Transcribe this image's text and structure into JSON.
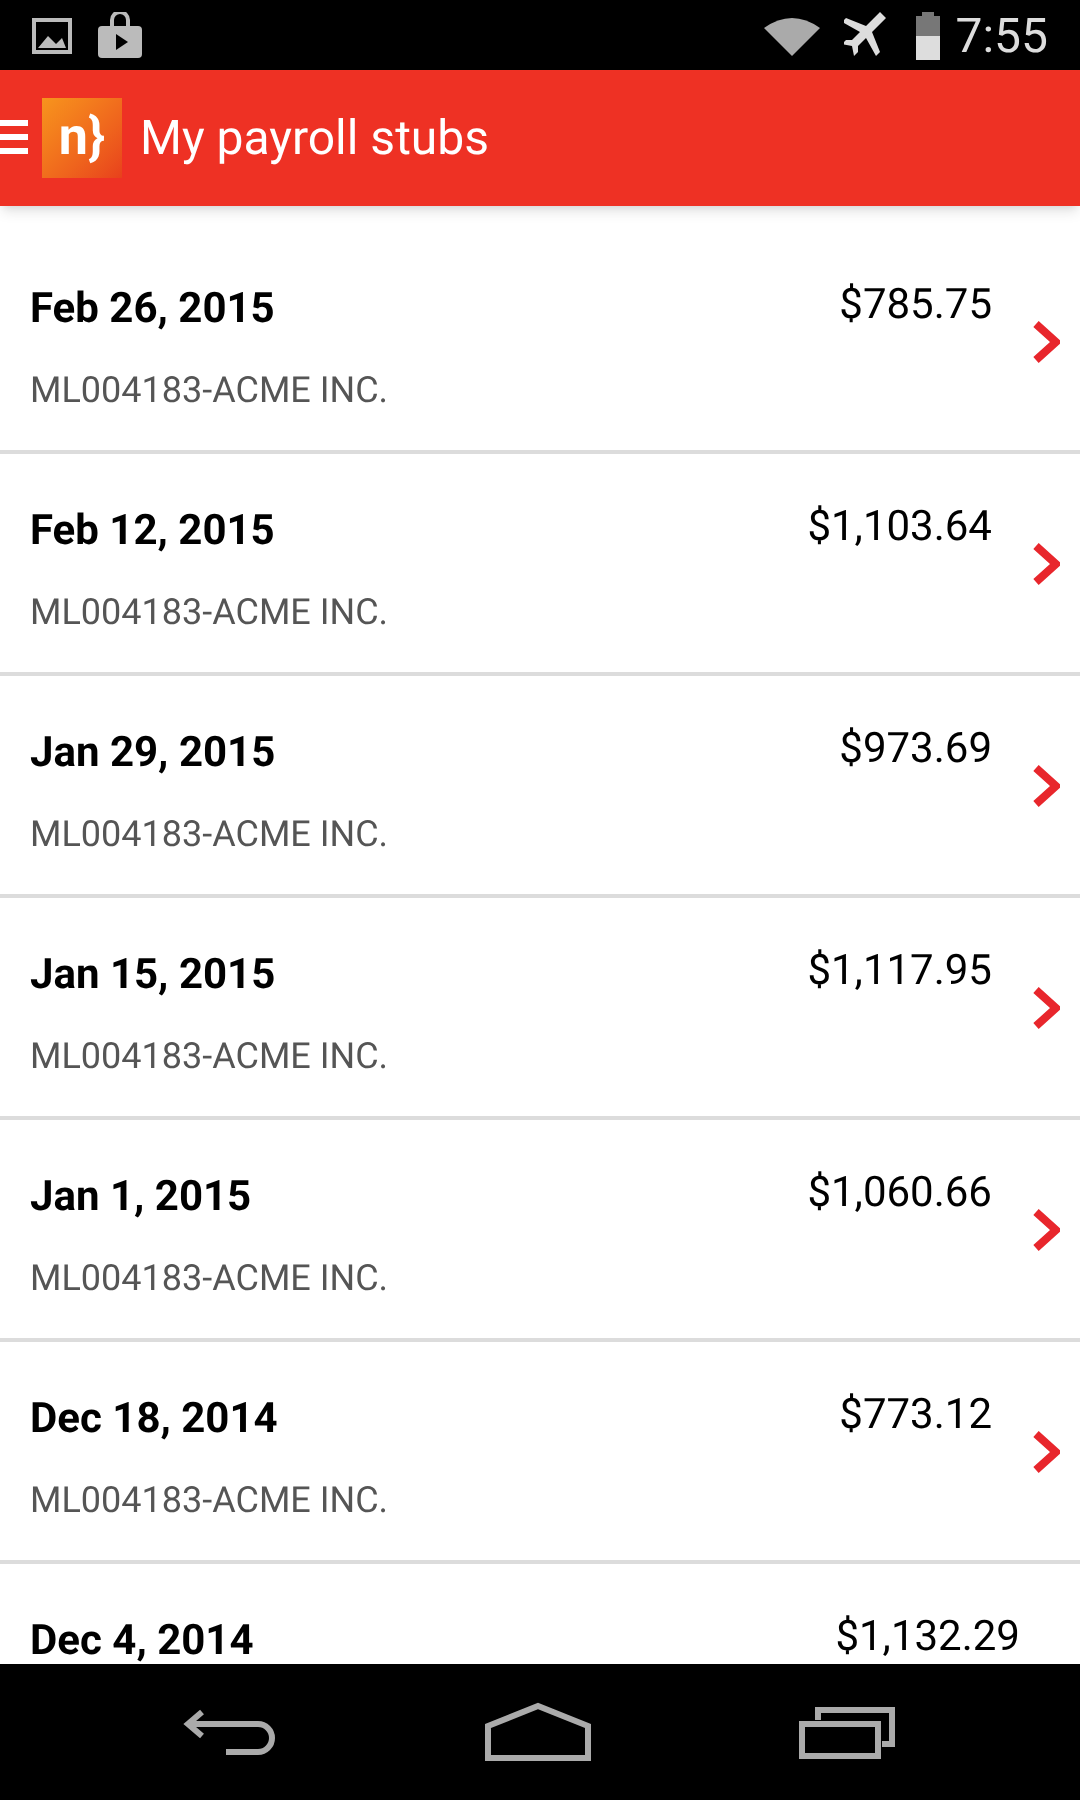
{
  "status_bar": {
    "time": "7:55"
  },
  "header": {
    "title": "My payroll stubs",
    "logo": "n}"
  },
  "stubs": [
    {
      "date": "Feb 26, 2015",
      "amount": "$785.75",
      "company": "ML004183-ACME INC."
    },
    {
      "date": "Feb 12, 2015",
      "amount": "$1,103.64",
      "company": "ML004183-ACME INC."
    },
    {
      "date": "Jan 29, 2015",
      "amount": "$973.69",
      "company": "ML004183-ACME INC."
    },
    {
      "date": "Jan 15, 2015",
      "amount": "$1,117.95",
      "company": "ML004183-ACME INC."
    },
    {
      "date": "Jan 1, 2015",
      "amount": "$1,060.66",
      "company": "ML004183-ACME INC."
    },
    {
      "date": "Dec 18, 2014",
      "amount": "$773.12",
      "company": "ML004183-ACME INC."
    },
    {
      "date": "Dec 4, 2014",
      "amount": "$1,132.29"
    }
  ]
}
